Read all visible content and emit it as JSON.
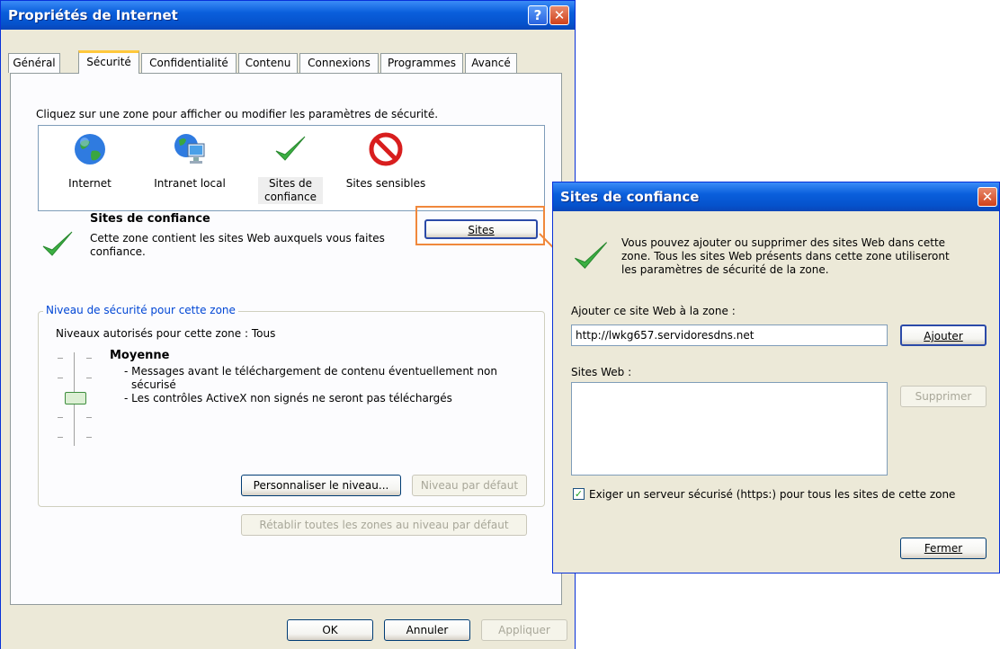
{
  "main_window": {
    "title": "Propriétés de Internet",
    "tabs": [
      "Général",
      "Sécurité",
      "Confidentialité",
      "Contenu",
      "Connexions",
      "Programmes",
      "Avancé"
    ],
    "active_tab": "Sécurité",
    "instruction": "Cliquez sur une zone pour afficher ou modifier les paramètres de sécurité.",
    "zones": [
      {
        "label_1": "Internet",
        "label_2": "",
        "icon": "globe-icon"
      },
      {
        "label_1": "Intranet local",
        "label_2": "",
        "icon": "intranet-icon"
      },
      {
        "label_1": "Sites de",
        "label_2": "confiance",
        "icon": "checkmark-icon"
      },
      {
        "label_1": "Sites sensibles",
        "label_2": "",
        "icon": "restricted-icon"
      }
    ],
    "selected_zone": {
      "title": "Sites de confiance",
      "desc_1": "Cette zone contient les sites Web auxquels vous faites",
      "desc_2": "confiance."
    },
    "sites_button": "Sites",
    "security_group": {
      "label": "Niveau de sécurité pour cette zone",
      "allowed_levels": "Niveaux autorisés pour cette zone : Tous",
      "level_name": "Moyenne",
      "bullet_1a": "- Messages avant le téléchargement de contenu éventuellement non",
      "bullet_1b": "sécurisé",
      "bullet_2": "- Les contrôles ActiveX non signés ne seront pas téléchargés",
      "custom_button": "Personnaliser le niveau...",
      "default_button": "Niveau par défaut"
    },
    "reset_all_button": "Rétablir toutes les zones au niveau par défaut",
    "ok_button": "OK",
    "cancel_button": "Annuler",
    "apply_button": "Appliquer"
  },
  "dialog": {
    "title": "Sites de confiance",
    "info_1": "Vous pouvez ajouter ou supprimer des sites Web dans cette",
    "info_2": "zone. Tous les sites Web présents dans cette zone utiliseront",
    "info_3": "les paramètres de sécurité de la zone.",
    "add_label": "Ajouter ce site Web à la zone :",
    "add_value": "http://lwkg657.servidoresdns.net",
    "add_button": "Ajouter",
    "sites_label": "Sites Web :",
    "sites_list": [],
    "remove_button": "Supprimer",
    "https_checkbox_label": "Exiger un serveur sécurisé (https:) pour tous les sites de cette zone",
    "https_checked": true,
    "close_button": "Fermer"
  },
  "colors": {
    "title_bar": "#0a5fdc",
    "highlight_box": "#f0883c",
    "group_label": "#0046d5"
  }
}
